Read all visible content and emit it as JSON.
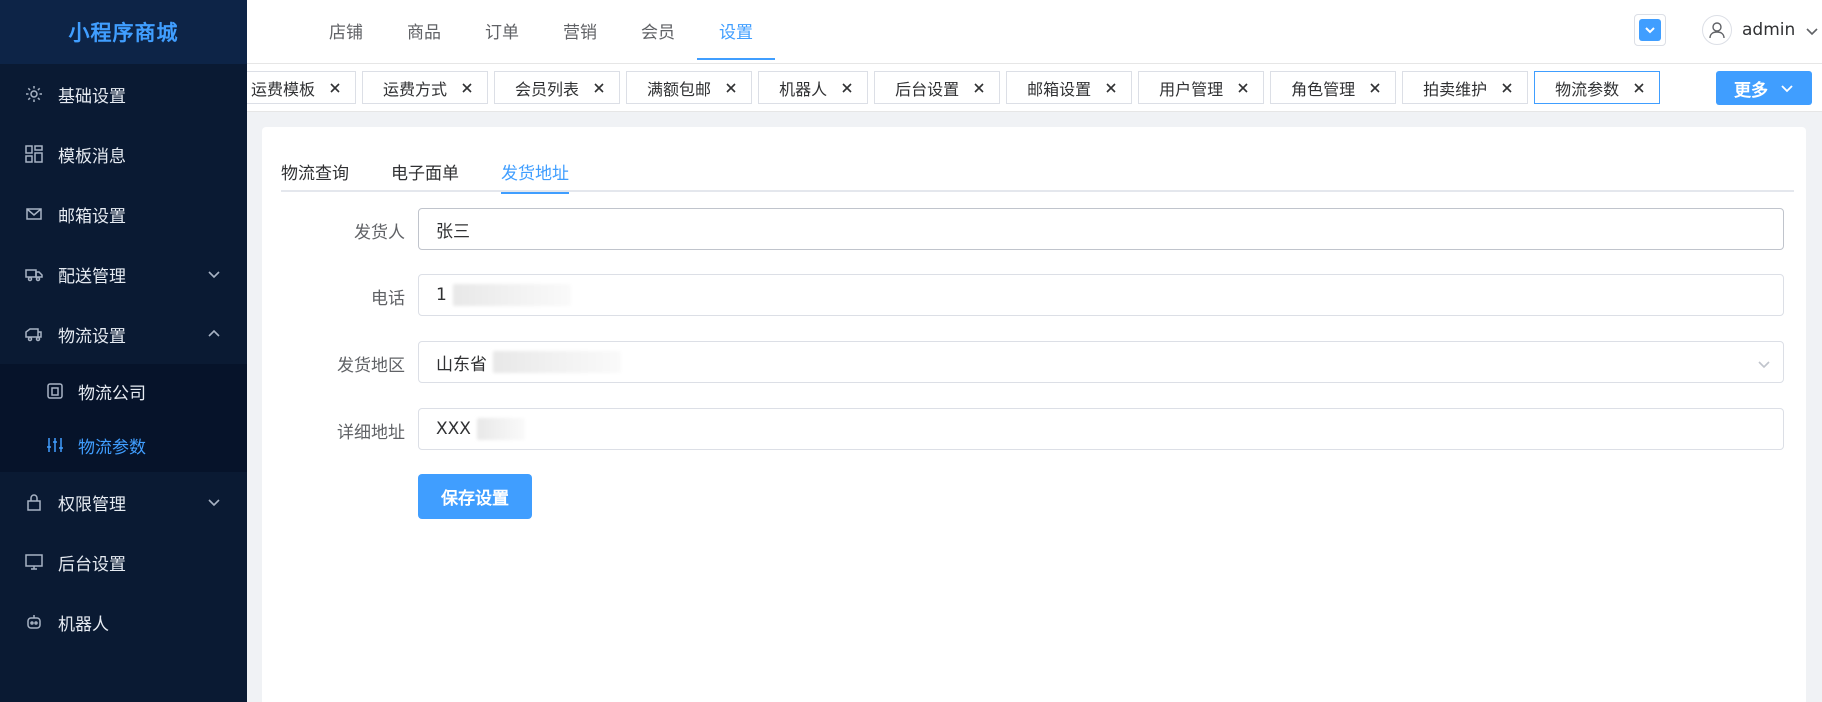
{
  "brand": "小程序商城",
  "sidebar": {
    "items": [
      {
        "label": "基础设置",
        "icon": "gear-icon"
      },
      {
        "label": "模板消息",
        "icon": "grid-icon"
      },
      {
        "label": "邮箱设置",
        "icon": "mail-icon"
      },
      {
        "label": "配送管理",
        "icon": "truck-icon"
      },
      {
        "label": "物流设置",
        "icon": "delivery-icon"
      },
      {
        "label": "权限管理",
        "icon": "lock-icon"
      },
      {
        "label": "后台设置",
        "icon": "monitor-icon"
      },
      {
        "label": "机器人",
        "icon": "robot-icon"
      }
    ],
    "submenu": [
      {
        "label": "物流公司",
        "icon": "building-icon"
      },
      {
        "label": "物流参数",
        "icon": "sliders-icon"
      }
    ]
  },
  "topnav": [
    "店铺",
    "商品",
    "订单",
    "营销",
    "会员",
    "设置"
  ],
  "user": {
    "name": "admin"
  },
  "tags": [
    "运费模板",
    "运费方式",
    "会员列表",
    "满额包邮",
    "机器人",
    "后台设置",
    "邮箱设置",
    "用户管理",
    "角色管理",
    "拍卖维护",
    "物流参数"
  ],
  "more_label": "更多",
  "subtabs": [
    "物流查询",
    "电子面单",
    "发货地址"
  ],
  "form": {
    "sender_label": "发货人",
    "sender_value": "张三",
    "phone_label": "电话",
    "phone_value": "1",
    "region_label": "发货地区",
    "region_value": "山东省",
    "address_label": "详细地址",
    "address_value": "XXX"
  },
  "save_label": "保存设置",
  "colors": {
    "accent": "#409eff",
    "sidebar_bg": "#0a1a33"
  }
}
